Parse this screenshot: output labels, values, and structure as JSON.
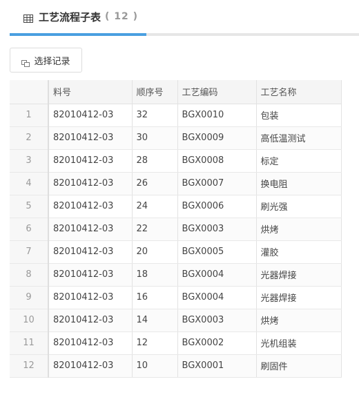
{
  "tab": {
    "title": "工艺流程子表",
    "count": "( 12 )"
  },
  "toolbar": {
    "select_label": "选择记录"
  },
  "table": {
    "columns": [
      "",
      "料号",
      "顺序号",
      "工艺编码",
      "工艺名称"
    ],
    "rows": [
      {
        "idx": "1",
        "part": "82010412-03",
        "seq": "32",
        "code": "BGX0010",
        "name": "包装"
      },
      {
        "idx": "2",
        "part": "82010412-03",
        "seq": "30",
        "code": "BGX0009",
        "name": "高低温测试"
      },
      {
        "idx": "3",
        "part": "82010412-03",
        "seq": "28",
        "code": "BGX0008",
        "name": "标定"
      },
      {
        "idx": "4",
        "part": "82010412-03",
        "seq": "26",
        "code": "BGX0007",
        "name": "换电阻"
      },
      {
        "idx": "5",
        "part": "82010412-03",
        "seq": "24",
        "code": "BGX0006",
        "name": "刷光强"
      },
      {
        "idx": "6",
        "part": "82010412-03",
        "seq": "22",
        "code": "BGX0003",
        "name": "烘烤"
      },
      {
        "idx": "7",
        "part": "82010412-03",
        "seq": "20",
        "code": "BGX0005",
        "name": "灌胶"
      },
      {
        "idx": "8",
        "part": "82010412-03",
        "seq": "18",
        "code": "BGX0004",
        "name": "光器焊接"
      },
      {
        "idx": "9",
        "part": "82010412-03",
        "seq": "16",
        "code": "BGX0004",
        "name": "光器焊接"
      },
      {
        "idx": "10",
        "part": "82010412-03",
        "seq": "14",
        "code": "BGX0003",
        "name": "烘烤"
      },
      {
        "idx": "11",
        "part": "82010412-03",
        "seq": "12",
        "code": "BGX0002",
        "name": "光机组装"
      },
      {
        "idx": "12",
        "part": "82010412-03",
        "seq": "10",
        "code": "BGX0001",
        "name": "刷固件"
      }
    ]
  },
  "colors": {
    "accent": "#4a9fe0",
    "header_bg": "#f5f5f5",
    "border": "#e2e2e2"
  },
  "icons": {
    "tab": "table-grid-icon",
    "button": "select-records-icon"
  }
}
